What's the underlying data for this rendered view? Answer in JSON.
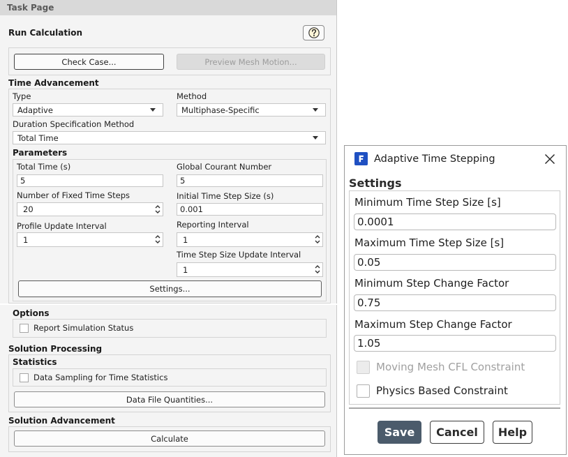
{
  "task_page": {
    "header_title": "Task Page",
    "title": "Run Calculation",
    "help_icon": "help-icon",
    "check_case_button": "Check Case...",
    "preview_mesh_motion_button": "Preview Mesh Motion...",
    "time_advancement": {
      "heading": "Time Advancement",
      "type": {
        "label": "Type",
        "value": "Adaptive"
      },
      "method": {
        "label": "Method",
        "value": "Multiphase-Specific"
      },
      "duration_method": {
        "label": "Duration Specification Method",
        "value": "Total Time"
      },
      "dropdown_icon": "chevron-down-icon"
    },
    "parameters": {
      "heading": "Parameters",
      "total_time": {
        "label": "Total Time (s)",
        "value": "5"
      },
      "global_courant_number": {
        "label": "Global Courant Number",
        "value": "5"
      },
      "fixed_time_steps": {
        "label": "Number of Fixed Time Steps",
        "value": "20"
      },
      "initial_time_step_size": {
        "label": "Initial Time Step Size (s)",
        "value": "0.001"
      },
      "profile_update_interval": {
        "label": "Profile Update Interval",
        "value": "1"
      },
      "reporting_interval": {
        "label": "Reporting Interval",
        "value": "1"
      },
      "time_step_size_update_interval": {
        "label": "Time Step Size Update Interval",
        "value": "1"
      },
      "settings_button": "Settings...",
      "spinner_icon": "spinner-arrows-icon"
    },
    "options": {
      "heading": "Options",
      "report_simulation_status": {
        "label": "Report Simulation Status",
        "checked": false
      }
    },
    "solution_processing": {
      "heading": "Solution Processing",
      "statistics_heading": "Statistics",
      "data_sampling": {
        "label": "Data Sampling for Time Statistics",
        "checked": false
      },
      "data_file_quantities_button": "Data File Quantities..."
    },
    "solution_advancement": {
      "heading": "Solution Advancement",
      "calculate_button": "Calculate"
    }
  },
  "dialog": {
    "title": "Adaptive Time Stepping",
    "app_icon": "fluent-app-icon",
    "close_icon": "close-icon",
    "settings_heading": "Settings",
    "fields": [
      {
        "label": "Minimum Time Step Size [s]",
        "value": "0.0001"
      },
      {
        "label": "Maximum Time Step Size [s]",
        "value": "0.05"
      },
      {
        "label": "Minimum Step Change Factor",
        "value": "0.75"
      },
      {
        "label": "Maximum Step Change Factor",
        "value": "1.05"
      }
    ],
    "moving_mesh_cfl_constraint": {
      "label": "Moving Mesh CFL Constraint",
      "checked": false,
      "enabled": false
    },
    "physics_based_constraint": {
      "label": "Physics Based Constraint",
      "checked": false,
      "enabled": true
    },
    "buttons": {
      "save": "Save",
      "cancel": "Cancel",
      "help": "Help"
    }
  },
  "colors": {
    "panel_background": "#f4f4f4",
    "header_background": "#d9d9d9",
    "save_button": "#4b5b6b",
    "app_icon": "#1f50c2",
    "disabled_text": "#a0a0a0"
  }
}
